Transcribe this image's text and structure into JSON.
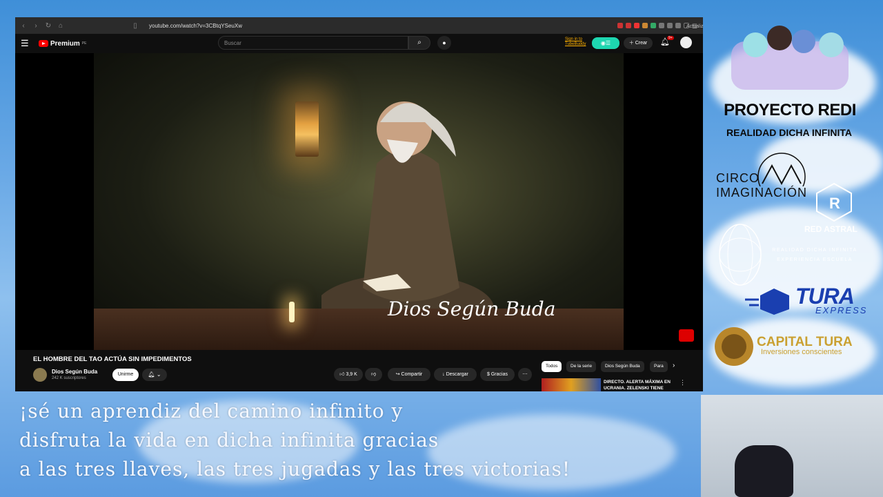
{
  "browser": {
    "url": "youtube.com/watch?v=3CBtqYSeuXw",
    "update_label": "Actualizar"
  },
  "youtube": {
    "logo": "Premium",
    "logo_region": "PE",
    "search_placeholder": "Buscar",
    "signin_line1": "Sign in to",
    "signin_line2": "TubeBuddy",
    "create_label": "Crear",
    "notifications_badge": "9+"
  },
  "video": {
    "watermark": "Dios Según Buda",
    "title": "EL HOMBRE DEL TAO ACTÚA SIN IMPEDIMENTOS",
    "channel_name": "Dios Según Buda",
    "subscribers": "242 K suscriptores",
    "join_label": "Unirme",
    "likes": "3,9 K",
    "share_label": "Compartir",
    "download_label": "Descargar",
    "thanks_label": "Gracias"
  },
  "chips": [
    "Todos",
    "De la serie",
    "Dios Según Buda",
    "Para"
  ],
  "recommendation": {
    "title": "DIRECTO. ALERTA MÁXIMA EN UCRANIA. ZELENSKI TIENE"
  },
  "panel": {
    "title": "PROYECTO REDI",
    "subtitle": "REALIDAD DICHA INFINITA",
    "circo_line1": "CIRCO",
    "circo_line2": "IMAGINACIÓN",
    "red_astral": "RED ASTRAL",
    "redi_line1": "REALIDAD DICHA INFINITA",
    "redi_line2": "EXPERIENCIA   ESCUELA",
    "tura": "TURA",
    "tura_sub": "EXPRESS",
    "capital": "CAPITAL TURA",
    "capital_sub": "Inversiones conscientes"
  },
  "subtitles": [
    "¡sé un aprendiz del camino infinito y",
    "disfruta la vida en dicha infinita gracias",
    "a las tres llaves, las tres jugadas y las tres victorias!"
  ]
}
